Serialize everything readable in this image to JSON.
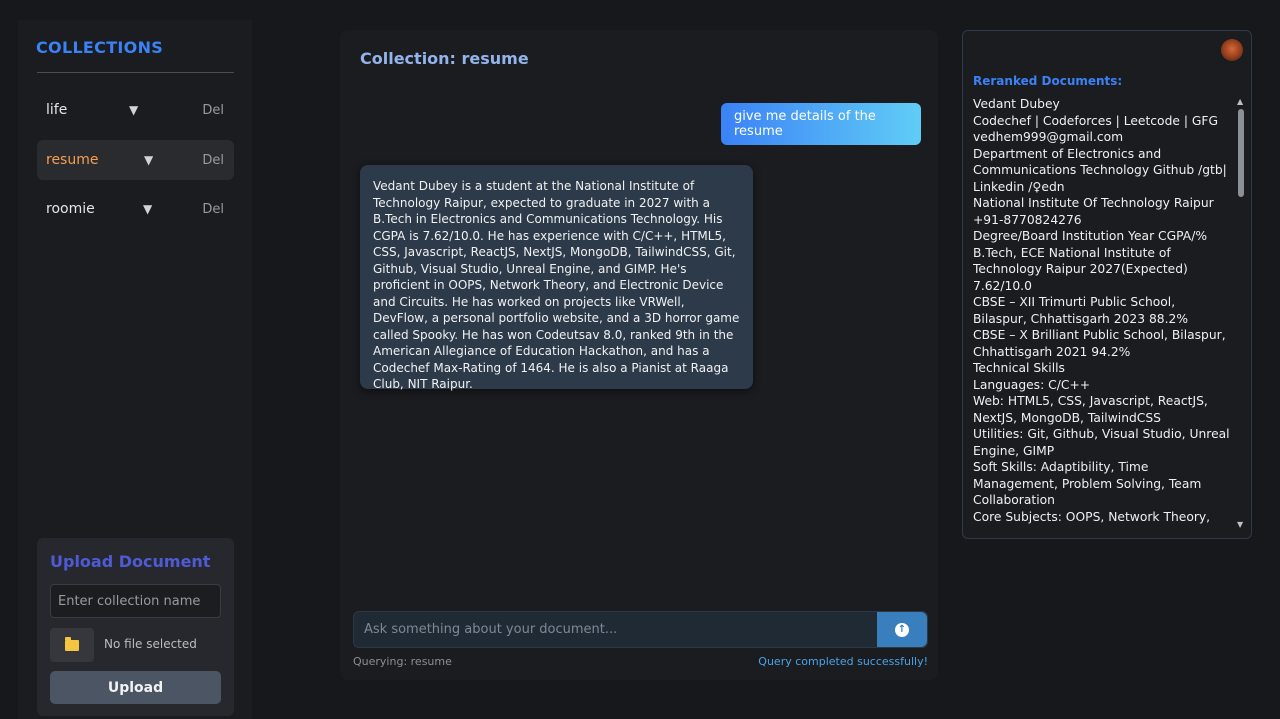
{
  "sidebar": {
    "title": "COLLECTIONS",
    "items": [
      {
        "name": "life",
        "arrow": "▼",
        "del": "Del"
      },
      {
        "name": "resume",
        "arrow": "▼",
        "del": "Del"
      },
      {
        "name": "roomie",
        "arrow": "▼",
        "del": "Del"
      }
    ],
    "upload": {
      "title": "Upload Document",
      "collection_placeholder": "Enter collection name",
      "file_label": "No file selected",
      "button_label": "Upload"
    }
  },
  "chat": {
    "title": "Collection: resume",
    "user_message": "give me details of the resume",
    "bot_message": "Vedant Dubey is a student at the National Institute of Technology Raipur, expected to graduate in 2027 with a B.Tech in Electronics and Communications Technology. His CGPA is 7.62/10.0. He has experience with C/C++, HTML5, CSS, Javascript, ReactJS, NextJS, MongoDB, TailwindCSS, Git, Github, Visual Studio, Unreal Engine, and GIMP. He's proficient in OOPS, Network Theory, and Electronic Device and Circuits. He has worked on projects like VRWell, DevFlow, a personal portfolio website, and a 3D horror game called Spooky. He has won Codeutsav 8.0, ranked 9th in the American Allegiance of Education Hackathon, and has a Codechef Max-Rating of 1464. He is also a Pianist at Raaga Club, NIT Raipur.",
    "input_placeholder": "Ask something about your document...",
    "status_left": "Querying: resume",
    "status_right": "Query completed successfully!"
  },
  "docs": {
    "title": "Reranked Documents:",
    "text": "Vedant Dubey\nCodechef | Codeforces | Leetcode | GFG\nvedhem999@gmail.com\nDepartment of Electronics and Communications Technology Github /gtb|\nLinkedin /♀edn\nNational Institute Of Technology Raipur +91-8770824276\nDegree/Board Institution Year CGPA/%\nB.Tech, ECE National Institute of Technology Raipur 2027(Expected) 7.62/10.0\nCBSE – XII Trimurti Public School, Bilaspur, Chhattisgarh 2023 88.2%\nCBSE – X Brilliant Public School, Bilaspur, Chhattisgarh 2021 94.2%\nTechnical Skills\nLanguages: C/C++\nWeb: HTML5, CSS, Javascript, ReactJS, NextJS, MongoDB, TailwindCSS\nUtilities: Git, Github, Visual Studio, Unreal Engine, GIMP\nSoft Skills: Adaptibility, Time Management, Problem Solving, Team Collaboration\nCore Subjects: OOPS, Network Theory, Electronic Device and Circuits\nOperating System: Windows, Linux"
  },
  "colors": {
    "accent": "#3b82f6",
    "active_item": "#f59e55",
    "upload_title": "#4f5bd5"
  }
}
